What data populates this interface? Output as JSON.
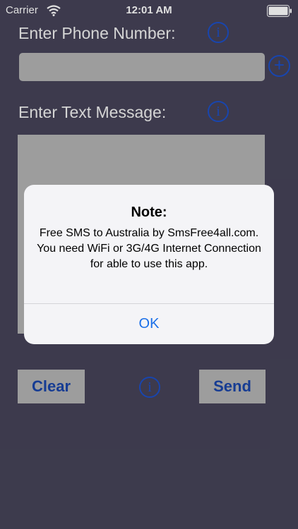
{
  "status_bar": {
    "carrier": "Carrier",
    "time": "12:01 AM"
  },
  "form": {
    "phone_label": "Enter Phone Number:",
    "message_label": "Enter Text Message:",
    "info_glyph": "i",
    "add_glyph": "+",
    "clear_label": "Clear",
    "send_label": "Send"
  },
  "alert": {
    "title": "Note:",
    "message": "Free SMS to Australia by SmsFree4all.com.  You need WiFi or 3G/4G Internet Connection for able to use this app.",
    "ok_label": "OK"
  },
  "colors": {
    "background": "#464358",
    "accent": "#1c4fc7",
    "field": "#b3b3b3",
    "alert_button": "#1a6fe8"
  },
  "icons": [
    "wifi-icon",
    "battery-icon",
    "info-icon",
    "add-icon"
  ]
}
